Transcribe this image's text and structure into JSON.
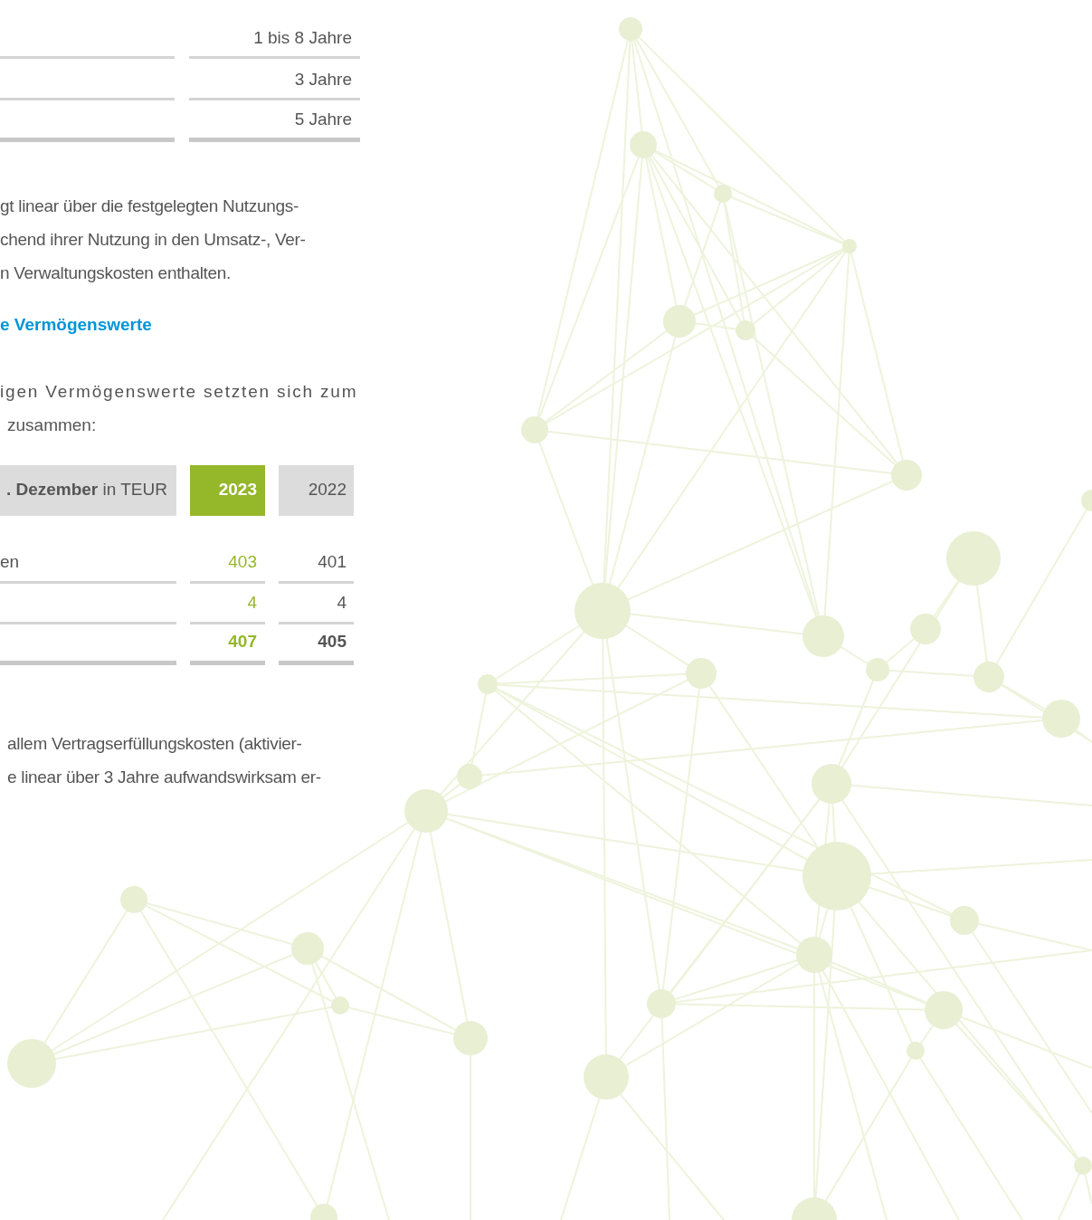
{
  "lifetime_table": {
    "rows": [
      {
        "value": "1 bis 8 Jahre",
        "kind": "item"
      },
      {
        "value": "3 Jahre",
        "kind": "item"
      },
      {
        "value": "5 Jahre",
        "kind": "total"
      }
    ]
  },
  "paragraph_1": {
    "lines": [
      "gt linear über die festgelegten Nutzungs-",
      "chend ihrer Nutzung in den Umsatz-, Ver-",
      "n Verwaltungskosten enthalten."
    ]
  },
  "heading": "e Vermögenswerte",
  "paragraph_2": {
    "lines": [
      "igen Vermögenswerte setzten sich zum",
      "zusammen:"
    ]
  },
  "assets_table": {
    "header": "**. Dezember** in TEUR",
    "columns": [
      {
        "label": "2023",
        "current": true
      },
      {
        "label": "2022",
        "current": false
      }
    ],
    "rows": [
      {
        "label": "en",
        "values": [
          "403",
          "401"
        ],
        "kind": "item"
      },
      {
        "values": [
          "4",
          "4"
        ],
        "kind": "item"
      },
      {
        "values": [
          "407",
          "405"
        ],
        "kind": "total"
      }
    ]
  },
  "paragraph_3": {
    "lines": [
      "allem Vertragserfüllungskosten (aktivier-",
      "e linear über 3 Jahre aufwandswirksam er-"
    ]
  }
}
